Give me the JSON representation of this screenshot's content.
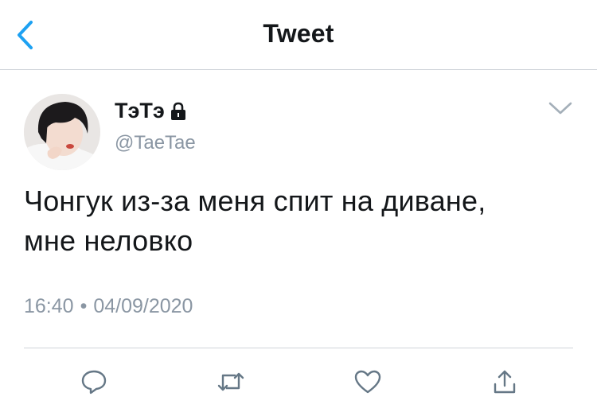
{
  "nav": {
    "title": "Tweet",
    "back_icon": "chevron-left-icon"
  },
  "tweet": {
    "display_name": "ТэТэ",
    "protected_icon": "lock-icon",
    "handle": "@TaeTae",
    "menu_icon": "chevron-down-icon",
    "text_lines": [
      "Чонгук из-за меня спит на диване,",
      "мне неловко"
    ],
    "time": "16:40",
    "separator": "•",
    "date": "04/09/2020"
  },
  "actions": {
    "reply_icon": "reply-icon",
    "retweet_icon": "retweet-icon",
    "like_icon": "heart-icon",
    "share_icon": "share-icon"
  },
  "colors": {
    "accent": "#1da1f2",
    "text": "#14171a",
    "secondary": "#8a96a3",
    "divider": "#cfd4d9"
  }
}
